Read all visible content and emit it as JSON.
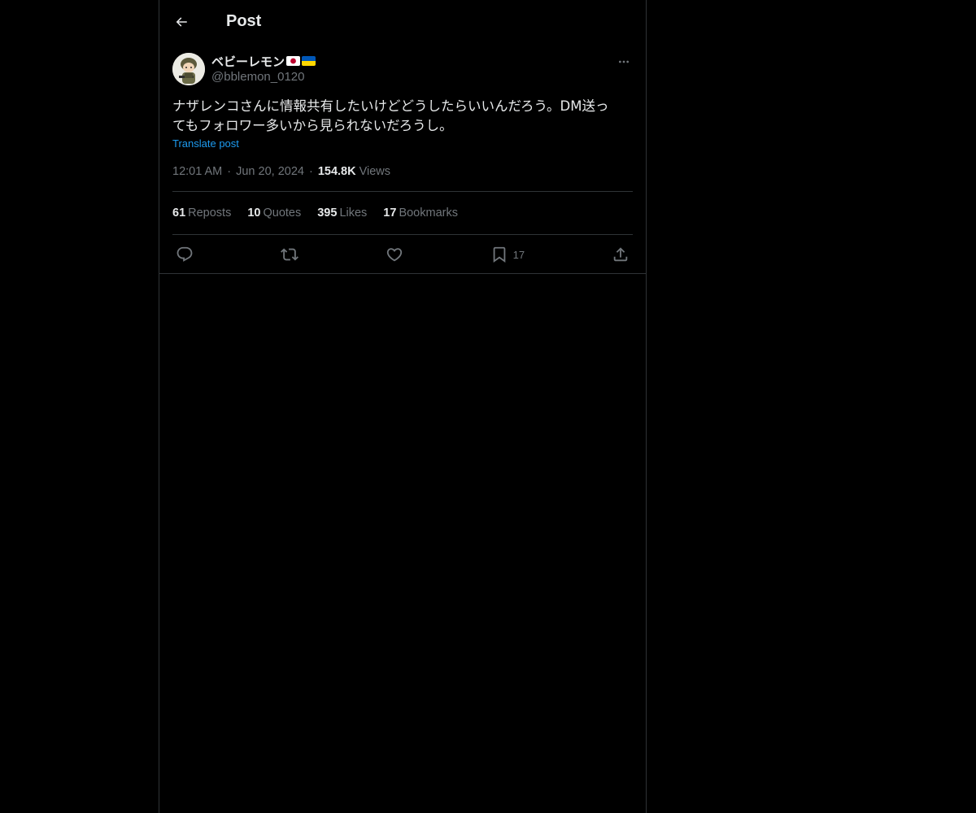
{
  "header": {
    "title": "Post"
  },
  "post": {
    "author": {
      "display_name": "ベビーレモン",
      "flags": [
        "japan-flag",
        "ukraine-flag"
      ],
      "handle": "@bblemon_0120"
    },
    "text": "ナザレンコさんに情報共有したいけどどうしたらいいんだろう。DM送っ\nてもフォロワー多いから見られないだろうし。",
    "translate_label": "Translate post",
    "time": "12:01 AM",
    "date": "Jun 20, 2024",
    "views_count": "154.8K",
    "views_label": "Views",
    "separator": "·"
  },
  "stats": [
    {
      "count": "61",
      "label": "Reposts"
    },
    {
      "count": "10",
      "label": "Quotes"
    },
    {
      "count": "395",
      "label": "Likes"
    },
    {
      "count": "17",
      "label": "Bookmarks"
    }
  ],
  "actions": {
    "reply_icon": "reply-icon",
    "repost_icon": "repost-icon",
    "like_icon": "heart-icon",
    "bookmark_icon": "bookmark-icon",
    "bookmark_count": "17",
    "share_icon": "share-icon"
  },
  "colors": {
    "background": "#000000",
    "text_primary": "#e7e9ea",
    "text_secondary": "#71767b",
    "accent": "#1d9bf0",
    "border": "#2f3336"
  }
}
